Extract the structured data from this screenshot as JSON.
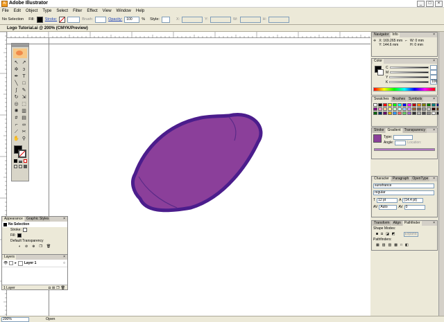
{
  "window": {
    "title": "Adobe Illustrator",
    "controls": [
      "_",
      "□",
      "×"
    ]
  },
  "menu": [
    "File",
    "Edit",
    "Object",
    "Type",
    "Select",
    "Filter",
    "Effect",
    "View",
    "Window",
    "Help"
  ],
  "control_bar": {
    "selection": "No Selection",
    "fill_label": "Fill:",
    "stroke_label": "Stroke:",
    "brush_label": "Brush:",
    "opacity_label": "Opacity:",
    "opacity_value": "100",
    "percent": "%",
    "style_label": "Style:",
    "x_label": "X:",
    "y_label": "Y:",
    "w_label": "W:",
    "h_label": "H:"
  },
  "document": {
    "title": "Logo Tutorial.ai @ 200% (CMYK/Preview)"
  },
  "info_panel": {
    "tabs": [
      "Navigator",
      "Info"
    ],
    "x": "X: 169.265 mm",
    "y": "Y: 144.6 mm",
    "w": "W: 0 mm",
    "h": "H: 0 mm"
  },
  "color_panel": {
    "tab": "Color",
    "channels": [
      "C",
      "M",
      "Y",
      "K"
    ],
    "k_value": "100"
  },
  "swatches_panel": {
    "tabs": [
      "Swatches",
      "Brushes",
      "Symbols"
    ]
  },
  "gradient_panel": {
    "tabs": [
      "Stroke",
      "Gradient",
      "Transparency"
    ],
    "type_label": "Type:",
    "angle_label": "Angle:",
    "location_label": "Location:"
  },
  "character_panel": {
    "tabs": [
      "Character",
      "Paragraph",
      "OpenType"
    ],
    "font": "sunsfrance",
    "style": "regular",
    "size": "12 pt",
    "leading": "(14.4 pt)",
    "kerning": "Auto",
    "tracking": "0"
  },
  "pathfinder_panel": {
    "tabs": [
      "Transform",
      "Align",
      "Pathfinder"
    ],
    "shape_modes": "Shape Modes:",
    "pathfinders": "Pathfinders:",
    "expand": "Expand"
  },
  "appearance_panel": {
    "tabs": [
      "Appearance",
      "Graphic Styles"
    ],
    "selection": "No Selection",
    "stroke": "Stroke:",
    "fill": "Fill:",
    "transparency": "Default Transparency"
  },
  "layers_panel": {
    "tab": "Layers",
    "layer_name": "Layer 1",
    "count": "1 Layer"
  },
  "status": {
    "zoom": "200%",
    "text": "Open"
  },
  "colors": {
    "shape_fill": "#8b3f9a",
    "shape_stroke": "#4b1d8c",
    "accent": "#1f43b8"
  }
}
